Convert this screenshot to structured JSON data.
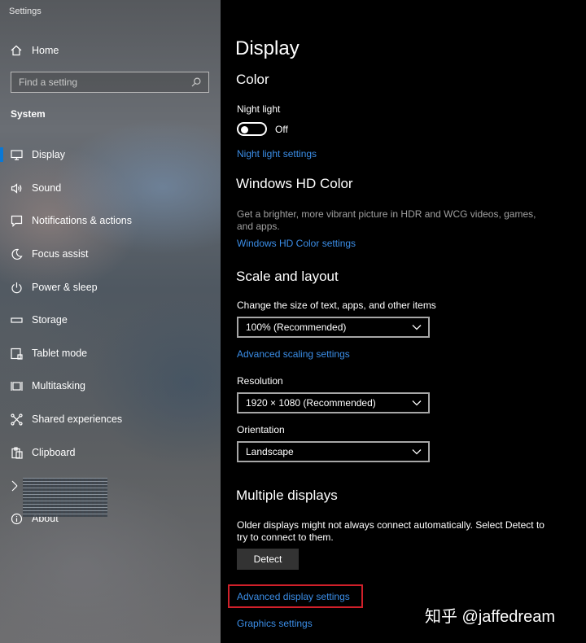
{
  "window": {
    "title": "Settings"
  },
  "sidebar": {
    "home_label": "Home",
    "search_placeholder": "Find a setting",
    "section_title": "System",
    "items": [
      {
        "label": "Display",
        "icon": "monitor-icon",
        "active": true
      },
      {
        "label": "Sound",
        "icon": "speaker-icon"
      },
      {
        "label": "Notifications & actions",
        "icon": "notification-icon"
      },
      {
        "label": "Focus assist",
        "icon": "moon-icon"
      },
      {
        "label": "Power & sleep",
        "icon": "power-icon"
      },
      {
        "label": "Storage",
        "icon": "storage-icon"
      },
      {
        "label": "Tablet mode",
        "icon": "tablet-mode-icon"
      },
      {
        "label": "Multitasking",
        "icon": "multitasking-icon"
      },
      {
        "label": "Shared experiences",
        "icon": "shared-experiences-icon"
      },
      {
        "label": "Clipboard",
        "icon": "clipboard-icon"
      },
      {
        "label": "",
        "icon": "remote-desktop-icon"
      },
      {
        "label": "About",
        "icon": "info-icon"
      }
    ]
  },
  "main": {
    "page_title": "Display",
    "color": {
      "heading": "Color",
      "night_light_label": "Night light",
      "night_light_state": "Off",
      "night_light_on": false,
      "night_light_settings_link": "Night light settings"
    },
    "hd_color": {
      "heading": "Windows HD Color",
      "description": "Get a brighter, more vibrant picture in HDR and WCG videos, games, and apps.",
      "settings_link": "Windows HD Color settings"
    },
    "scale": {
      "heading": "Scale and layout",
      "size_label": "Change the size of text, apps, and other items",
      "size_value": "100% (Recommended)",
      "advanced_scaling_link": "Advanced scaling settings",
      "resolution_label": "Resolution",
      "resolution_value": "1920 × 1080 (Recommended)",
      "orientation_label": "Orientation",
      "orientation_value": "Landscape"
    },
    "multiple_displays": {
      "heading": "Multiple displays",
      "description": "Older displays might not always connect automatically. Select Detect to try to connect to them.",
      "detect_button": "Detect",
      "advanced_display_link": "Advanced display settings",
      "graphics_link": "Graphics settings"
    }
  },
  "watermark": "知乎 @jaffedream",
  "colors": {
    "accent": "#0a78d4",
    "link": "#3b8ee8",
    "highlight": "#d0202a",
    "background": "#000000"
  }
}
